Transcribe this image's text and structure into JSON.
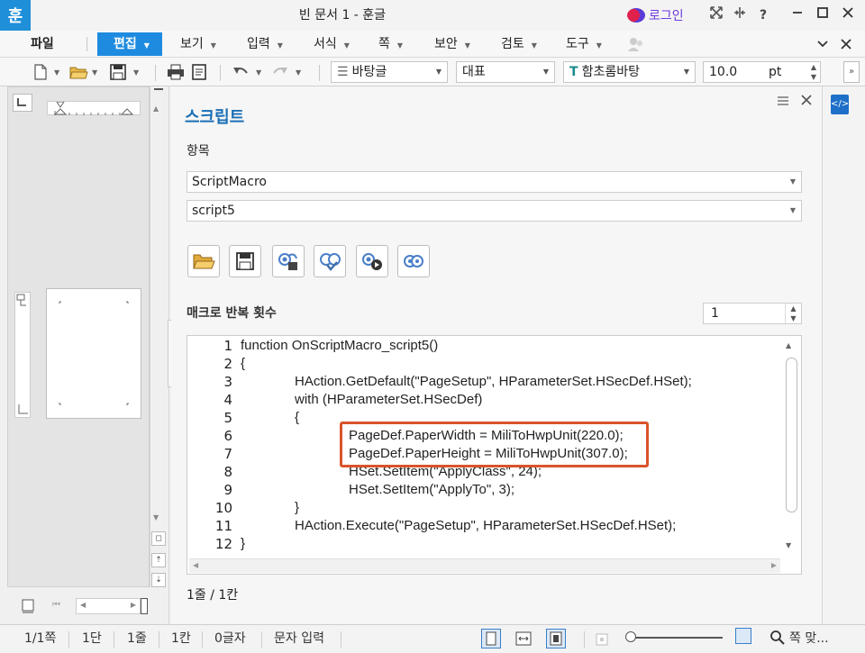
{
  "titlebar": {
    "app_icon": "훈",
    "title": "빈 문서 1 - 훈글",
    "login": "로그인",
    "controls": [
      "fullscreen-icon",
      "split-icon",
      "help-icon",
      "minimize-icon",
      "maximize-icon",
      "close-icon"
    ],
    "help": "?"
  },
  "menubar": {
    "items": [
      {
        "label": "파일"
      },
      {
        "label": "편집"
      },
      {
        "label": "보기"
      },
      {
        "label": "입력"
      },
      {
        "label": "서식"
      },
      {
        "label": "쪽"
      },
      {
        "label": "보안"
      },
      {
        "label": "검토"
      },
      {
        "label": "도구"
      }
    ]
  },
  "toolbar": {
    "style_combo": "바탕글",
    "lang_combo": "대표",
    "font_combo": "함초롬바탕",
    "font_size": "10.0",
    "unit": "pt"
  },
  "script_panel": {
    "title": "스크립트",
    "item_label": "항목",
    "item_combo_1": "ScriptMacro",
    "item_combo_2": "script5",
    "repeat_label": "매크로 반복 횟수",
    "repeat_value": "1",
    "code_lines": [
      {
        "n": "1",
        "indent": 0,
        "text": "function OnScriptMacro_script5()"
      },
      {
        "n": "2",
        "indent": 0,
        "text": "{"
      },
      {
        "n": "3",
        "indent": 1,
        "text": "HAction.GetDefault(\"PageSetup\", HParameterSet.HSecDef.HSet);"
      },
      {
        "n": "4",
        "indent": 1,
        "text": "with (HParameterSet.HSecDef)"
      },
      {
        "n": "5",
        "indent": 1,
        "text": "{"
      },
      {
        "n": "6",
        "indent": 2,
        "text": "PageDef.PaperWidth = MiliToHwpUnit(220.0);"
      },
      {
        "n": "7",
        "indent": 2,
        "text": "PageDef.PaperHeight = MiliToHwpUnit(307.0);"
      },
      {
        "n": "8",
        "indent": 2,
        "text": "HSet.SetItem(\"ApplyClass\", 24);"
      },
      {
        "n": "9",
        "indent": 2,
        "text": "HSet.SetItem(\"ApplyTo\", 3);"
      },
      {
        "n": "10",
        "indent": 1,
        "text": "}"
      },
      {
        "n": "11",
        "indent": 1,
        "text": "HAction.Execute(\"PageSetup\", HParameterSet.HSecDef.HSet);"
      },
      {
        "n": "12",
        "indent": 0,
        "text": "}"
      }
    ],
    "cursor_position": "1줄 / 1칸",
    "highlight_color": "#d9542b"
  },
  "statusbar": {
    "page": "1/1쪽",
    "section": "1단",
    "line": "1줄",
    "column": "1칸",
    "chars": "0글자",
    "mode": "문자 입력",
    "zoom": "쪽 맞..."
  },
  "colors": {
    "accent": "#1e8be0",
    "title_blue": "#1a6fb5",
    "login_purple": "#6d3be0"
  }
}
